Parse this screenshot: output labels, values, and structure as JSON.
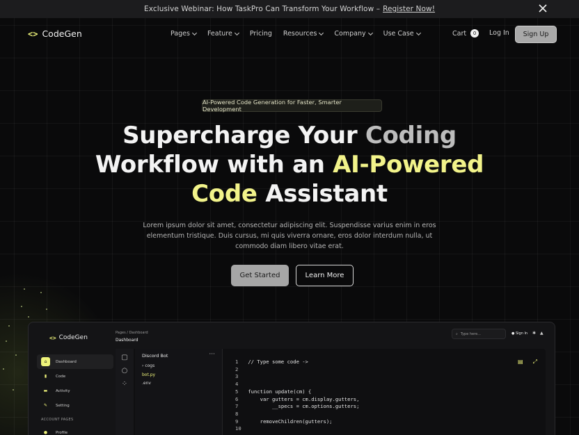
{
  "announcement": {
    "text": "Exclusive Webinar: How TaskPro Can Transform Your Workflow –",
    "link": "Register Now!",
    "close_icon": "close-icon"
  },
  "nav": {
    "logo_glyph": "<>",
    "logo_text": "CodeGen",
    "items": [
      "Pages",
      "Feature",
      "Pricing",
      "Resources",
      "Company",
      "Use Case"
    ],
    "cart_label": "Cart",
    "cart_count": "0",
    "login": "Log In",
    "signup": "Sign Up"
  },
  "hero": {
    "pill": "AI-Powered Code Generation for Faster, Smarter Development",
    "headline": {
      "w1": "Supercharge Your",
      "w2": "Coding",
      "w3": "Workflow with an",
      "w4": "AI-Powered",
      "w5": "Code",
      "w6": "Assistant"
    },
    "subtext": "Lorem ipsum dolor sit amet, consectetur adipiscing elit. Suspendisse varius enim in eros elementum tristique. Duis cursus, mi quis viverra ornare, eros dolor interdum nulla, ut commodo diam libero vitae erat.",
    "primary_cta": "Get Started",
    "secondary_cta": "Learn More"
  },
  "preview": {
    "logo_text": "CodeGen",
    "breadcrumb": "Pages  /  Dashboard",
    "page_title": "Dashboard",
    "search_placeholder": "Type here...",
    "signin": "Sign In",
    "sidebar": {
      "items": [
        "Dashboard",
        "Code",
        "Activity",
        "Setting"
      ],
      "section": "ACCOUNT PAGES",
      "account_items": [
        "Profile"
      ]
    },
    "files": {
      "title": "Discord Bot",
      "entries": [
        "cogs",
        "bot.py",
        ".env"
      ]
    },
    "code": [
      {
        "n": "1",
        "t": "// Type some code ->"
      },
      {
        "n": "2",
        "t": ""
      },
      {
        "n": "3",
        "t": ""
      },
      {
        "n": "4",
        "t": ""
      },
      {
        "n": "5",
        "t": "function update(cm) {"
      },
      {
        "n": "6",
        "t": "    var gutters = cm.display.gutters,"
      },
      {
        "n": "7",
        "t": "        __specs = cm.options.gutters;"
      },
      {
        "n": "8",
        "t": ""
      },
      {
        "n": "9",
        "t": "    removeChildren(gutters);"
      },
      {
        "n": "10",
        "t": ""
      }
    ]
  },
  "colors": {
    "accent": "#f2f38a",
    "background": "#0a0a0b",
    "button_primary": "#a6a6a6"
  }
}
